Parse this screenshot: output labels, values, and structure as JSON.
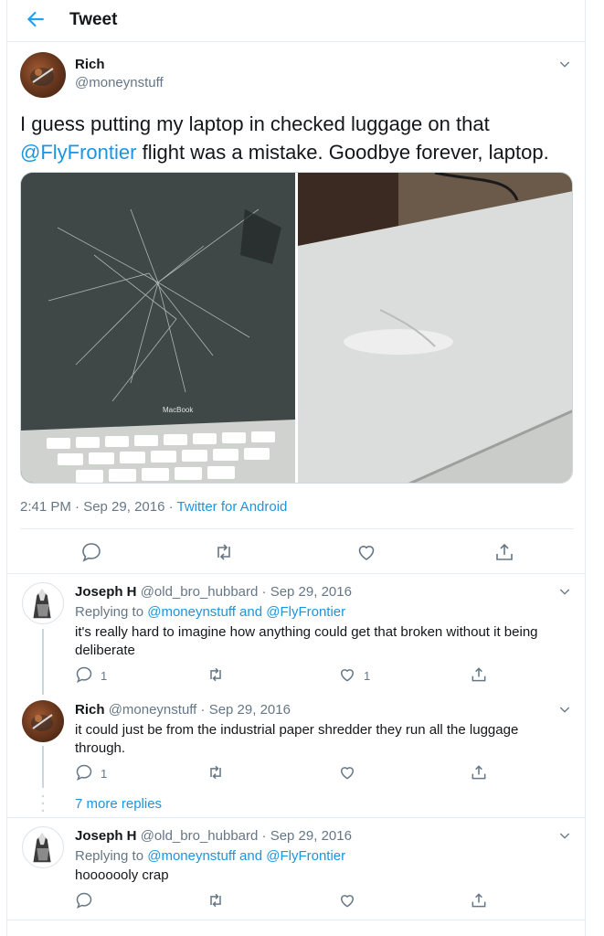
{
  "header": {
    "title": "Tweet"
  },
  "main_tweet": {
    "name": "Rich",
    "handle": "@moneynstuff",
    "text_before": "I guess putting my laptop in checked luggage on that ",
    "mention": "@FlyFrontier",
    "text_after": " flight was a mistake. Goodbye forever, laptop.",
    "photo_label": "MacBook",
    "time": "2:41 PM · Sep 29, 2016 · ",
    "source": "Twitter for Android"
  },
  "replies": [
    {
      "name": "Joseph H",
      "handle": "@old_bro_hubbard",
      "date": " · Sep 29, 2016",
      "replying_prefix": "Replying to ",
      "replying_to": "@moneynstuff and @FlyFrontier",
      "text": "it's really hard to imagine how anything could get that broken without it being deliberate",
      "reply_count": "1",
      "retweet_count": "",
      "like_count": "1"
    },
    {
      "name": "Rich",
      "handle": "@moneynstuff",
      "date": " · Sep 29, 2016",
      "text": "it could just be from the industrial paper shredder they run all the luggage through.",
      "reply_count": "1",
      "retweet_count": "",
      "like_count": ""
    },
    {
      "name": "Joseph H",
      "handle": "@old_bro_hubbard",
      "date": " · Sep 29, 2016",
      "replying_prefix": "Replying to ",
      "replying_to": "@moneynstuff and @FlyFrontier",
      "text": "hooooooly crap",
      "reply_count": "",
      "retweet_count": "",
      "like_count": ""
    }
  ],
  "more_replies": "7 more replies",
  "colors": {
    "accent": "#1b95e0",
    "muted": "#657786",
    "border": "#e6ecf0"
  },
  "icons": [
    "back-arrow-icon",
    "chevron-down-icon",
    "reply-icon",
    "retweet-icon",
    "like-icon",
    "share-icon"
  ]
}
